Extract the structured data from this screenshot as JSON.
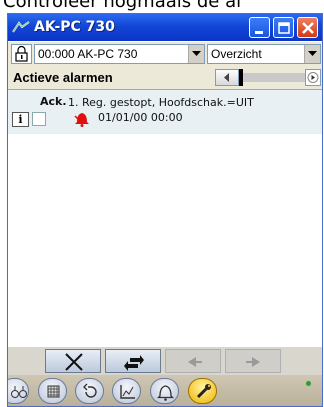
{
  "caption": "Controleer nogmaals de al",
  "window": {
    "title": "AK-PC 730",
    "controls": [
      "minimize",
      "maximize",
      "close"
    ]
  },
  "toolbar": {
    "lock_icon": "lock-icon",
    "device_select": "00:000 AK-PC 730",
    "view_select": "Overzicht"
  },
  "alarms_header": {
    "title": "Actieve alarmen"
  },
  "alarms": [
    {
      "ack_label": "Ack.",
      "text": "1. Reg. gestopt, Hoofdschak.=UIT",
      "time": "01/01/00 00:00",
      "icon": "bell-icon",
      "info_label": "i"
    }
  ],
  "actions": [
    {
      "name": "clear",
      "icon": "x-icon",
      "enabled": true
    },
    {
      "name": "refresh",
      "icon": "refresh-icon",
      "enabled": true
    },
    {
      "name": "previous",
      "icon": "arrow-left-icon",
      "enabled": false
    },
    {
      "name": "next",
      "icon": "arrow-right-icon",
      "enabled": false
    }
  ],
  "nav": [
    {
      "name": "binoculars",
      "icon": "binoculars-icon",
      "active": false
    },
    {
      "name": "grid",
      "icon": "grid-icon",
      "active": false
    },
    {
      "name": "undo",
      "icon": "undo-icon",
      "active": false
    },
    {
      "name": "trend",
      "icon": "chart-icon",
      "active": false
    },
    {
      "name": "alarm",
      "icon": "bell-outline-icon",
      "active": false
    },
    {
      "name": "service",
      "icon": "wrench-icon",
      "active": true
    }
  ],
  "colors": {
    "titlebar": "#0a35c7",
    "alarm_row": "#e8f0f4",
    "bell": "#e01010",
    "active_nav": "#f0b400",
    "status_dot": "#2aa02a"
  }
}
